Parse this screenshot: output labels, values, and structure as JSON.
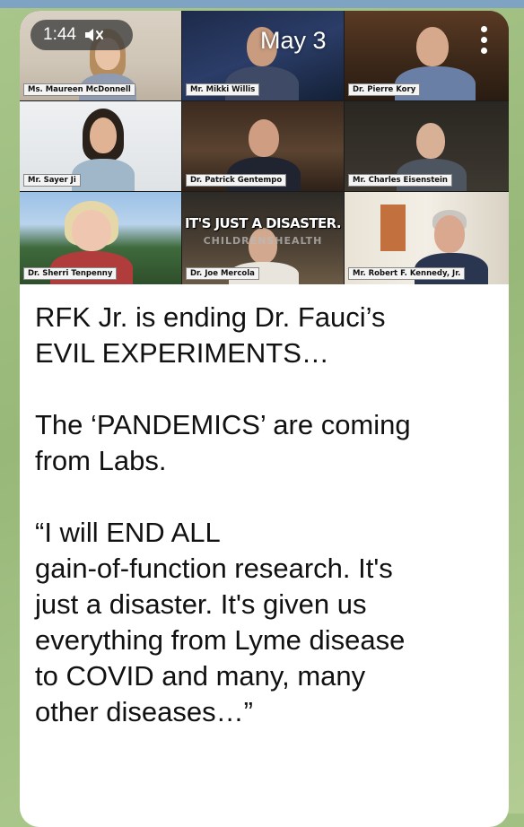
{
  "video": {
    "time": "1:44",
    "date_label": "May 3",
    "caption": "IT'S JUST A DISASTER.",
    "caption_secondary": "CHILDRENSHEALTH",
    "participants": [
      "Ms. Maureen McDonnell",
      "Mr. Mikki Willis",
      "Dr. Pierre Kory",
      "Mr. Sayer Ji",
      "Dr. Patrick Gentempo",
      "Mr. Charles Eisenstein",
      "Dr. Sherri Tenpenny",
      "Dr. Joe Mercola",
      "Mr. Robert F. Kennedy, Jr."
    ]
  },
  "message": {
    "text": "RFK Jr. is ending Dr. Fauci’s\nEVIL EXPERIMENTS…\n\nThe ‘PANDEMICS’ are coming\nfrom Labs.\n\n“I will END ALL\ngain-of-function research. It's\njust a disaster. It's given us\neverything from Lyme disease\nto COVID and many, many\nother diseases…”"
  },
  "icons": [
    "mute-icon",
    "more-menu-icon"
  ],
  "colors": {
    "background": "#a9c68a",
    "bubble": "#ffffff",
    "active_speaker": "#5ec95e"
  }
}
